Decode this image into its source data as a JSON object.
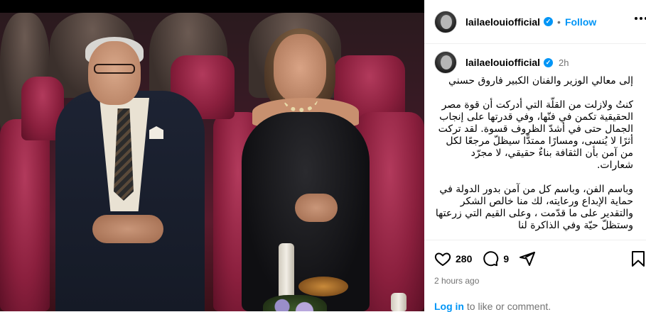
{
  "post": {
    "username": "lailaelouiofficial",
    "verified_mark": "✓",
    "separator": "•",
    "follow_label": "Follow",
    "more_icon": "more-horizontal-icon"
  },
  "caption": {
    "username": "lailaelouiofficial",
    "time_ago": "2h",
    "text": "إلى معالي الوزير والفنان الكبير فاروق حسني\n\nكنتُ ولازلت من القلّة التي أدركت أن قوة مصر الحقيقية تكمن في فنّها، وفي قدرتها على إنجاب الجمال حتى في أشدّ الظروف قسوة. لقد تركت أثرًا لا يُنسى، ومسارًا ممتدًّا سيظلّ مرجعًا لكل من آمن بأن الثقافة بناءٌ حقيقي، لا مجرّد شعارات.\n\nوباسم الفن، وباسم كل من آمن بدور الدولة في حماية الإبداع ورعايته، لك منا خالص الشكر والتقدير على ما قدّمت ، وعلى القيم التي زرعتها وستظلّ حيّة وفي الذاكرة لنا"
  },
  "actions": {
    "like_icon": "heart-icon",
    "like_count": "280",
    "comment_icon": "comment-icon",
    "comment_count": "9",
    "share_icon": "share-icon",
    "save_icon": "bookmark-icon"
  },
  "footer": {
    "posted": "2 hours ago",
    "login_link": "Log in",
    "login_rest": " to like or comment."
  }
}
